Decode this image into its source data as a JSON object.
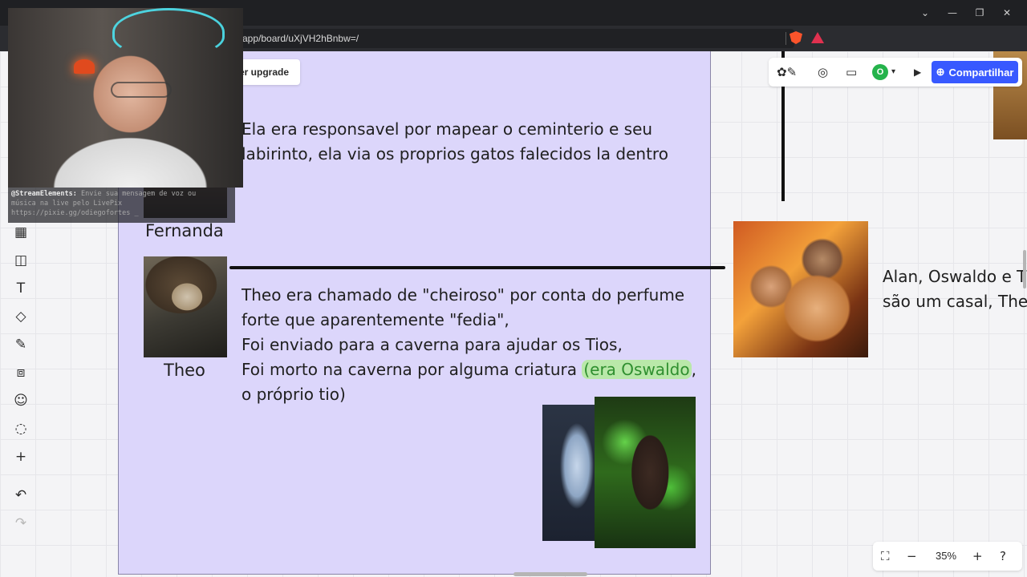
{
  "browser": {
    "url": "app/board/uXjVH2hBnbw=/",
    "window_controls": [
      "⌄",
      "—",
      "❐",
      "✕"
    ]
  },
  "board": {
    "upgrade_label": "zer upgrade",
    "share_label": "Compartilhar",
    "avatar_initial": "O",
    "zoom": "35%",
    "frame_color": "#dcd6fb",
    "accent_color": "#3859ff"
  },
  "content": {
    "fernanda_text": "Ela era responsavel por mapear o ceminterio e seu\nlabirinto, ela via os proprios gatos falecidos la dentro",
    "fernanda_name": "Fernanda",
    "theo_name": "Theo",
    "theo_lines": [
      "Theo era chamado de \"cheiroso\" por conta do perfume",
      "forte que aparentemente \"fedia\",",
      "Foi enviado para a caverna para ajudar os Tios,"
    ],
    "theo_line4_prefix": "Foi morto na caverna por alguma criatura ",
    "theo_line4_highlight": "(era Oswaldo",
    "theo_line4_suffix": ",",
    "theo_line5": "o próprio tio)",
    "right_text_line1": "Alan, Oswaldo e T",
    "right_text_line2": "são um casal, Theo"
  },
  "stream": {
    "chat_user": "@StreamElements:",
    "chat_msg1": " Envie sua mensagem de voz ou",
    "chat_msg2": "música na live pelo LivePix",
    "chat_link": "https://pixie.gg/odiegofortes _"
  }
}
